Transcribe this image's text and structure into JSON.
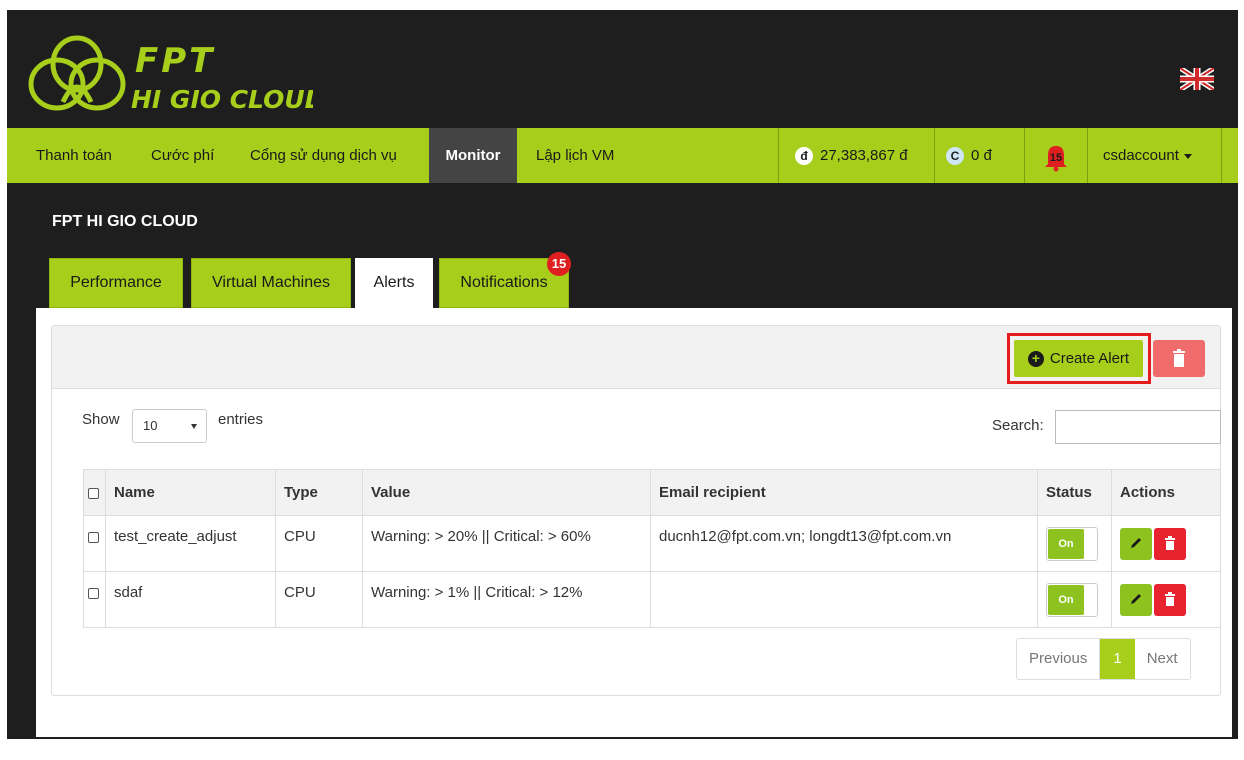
{
  "brand": {
    "line1": "FPT",
    "line2": "HI GIO CLOUD"
  },
  "nav": {
    "items": [
      "Thanh toán",
      "Cước phí",
      "Cổng sử dụng dịch vụ",
      "Monitor",
      "Lập lịch VM"
    ],
    "active": "Monitor",
    "balance": "27,383,867 đ",
    "balance_icon": "đ",
    "credit": "0 đ",
    "credit_icon": "C",
    "notification_count": "15",
    "user": "csdaccount"
  },
  "page": {
    "title": "FPT HI GIO CLOUD",
    "tabs": [
      "Performance",
      "Virtual Machines",
      "Alerts",
      "Notifications"
    ],
    "active_tab": "Alerts",
    "notifications_badge": "15"
  },
  "toolbar": {
    "create_label": "Create Alert"
  },
  "list": {
    "show_label": "Show",
    "page_size": "10",
    "entries_label": "entries",
    "search_label": "Search:",
    "search_value": ""
  },
  "table": {
    "columns": [
      "Name",
      "Type",
      "Value",
      "Email recipient",
      "Status",
      "Actions"
    ],
    "rows": [
      {
        "name": "test_create_adjust",
        "type": "CPU",
        "value": "Warning: > 20% || Critical: > 60%",
        "email": "ducnh12@fpt.com.vn; longdt13@fpt.com.vn",
        "status": "On"
      },
      {
        "name": "sdaf",
        "type": "CPU",
        "value": "Warning: > 1% || Critical: > 12%",
        "email": "",
        "status": "On"
      }
    ]
  },
  "pagination": {
    "previous": "Previous",
    "current": "1",
    "next": "Next"
  },
  "colors": {
    "accent": "#a6ce1b",
    "dark": "#1e1e1e",
    "danger": "#e8232f"
  }
}
